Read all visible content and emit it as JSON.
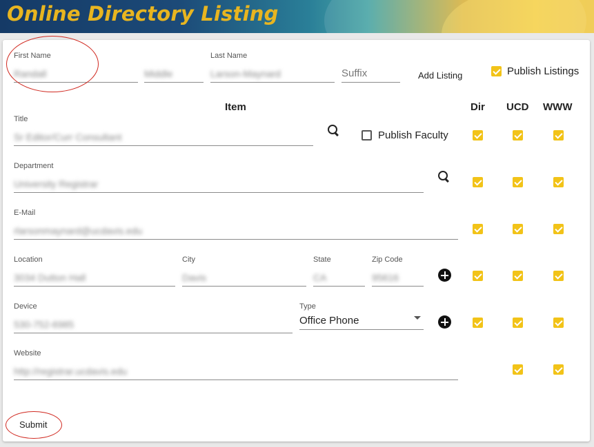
{
  "header": {
    "title": "Online Directory Listing"
  },
  "name_row": {
    "first_name": {
      "label": "First Name",
      "value": "Randall"
    },
    "middle": {
      "value": "Middle"
    },
    "last_name": {
      "label": "Last Name",
      "value": "Larson-Maynard"
    },
    "suffix": {
      "placeholder": "Suffix"
    },
    "add_listing": "Add Listing",
    "publish_listings": {
      "label": "Publish Listings",
      "checked": true
    }
  },
  "columns": {
    "item": "Item",
    "dir": "Dir",
    "ucd": "UCD",
    "www": "WWW"
  },
  "title_row": {
    "label": "Title",
    "value": "Sr Editor/Curr Consultant",
    "publish_faculty": {
      "label": "Publish Faculty",
      "checked": false
    }
  },
  "department_row": {
    "label": "Department",
    "value": "University Registrar"
  },
  "email_row": {
    "label": "E-Mail",
    "value": "rlarsonmaynard@ucdavis.edu"
  },
  "location_row": {
    "location": {
      "label": "Location",
      "value": "3034 Dutton Hall"
    },
    "city": {
      "label": "City",
      "value": "Davis"
    },
    "state": {
      "label": "State",
      "value": "CA"
    },
    "zip": {
      "label": "Zip Code",
      "value": "95616"
    }
  },
  "device_row": {
    "device": {
      "label": "Device",
      "value": "530-752-6985"
    },
    "type": {
      "label": "Type",
      "value": "Office Phone"
    }
  },
  "website_row": {
    "label": "Website",
    "value": "http://registrar.ucdavis.edu"
  },
  "submit": "Submit",
  "colors": {
    "accent": "#f2c318",
    "annotation": "#d0281f"
  }
}
